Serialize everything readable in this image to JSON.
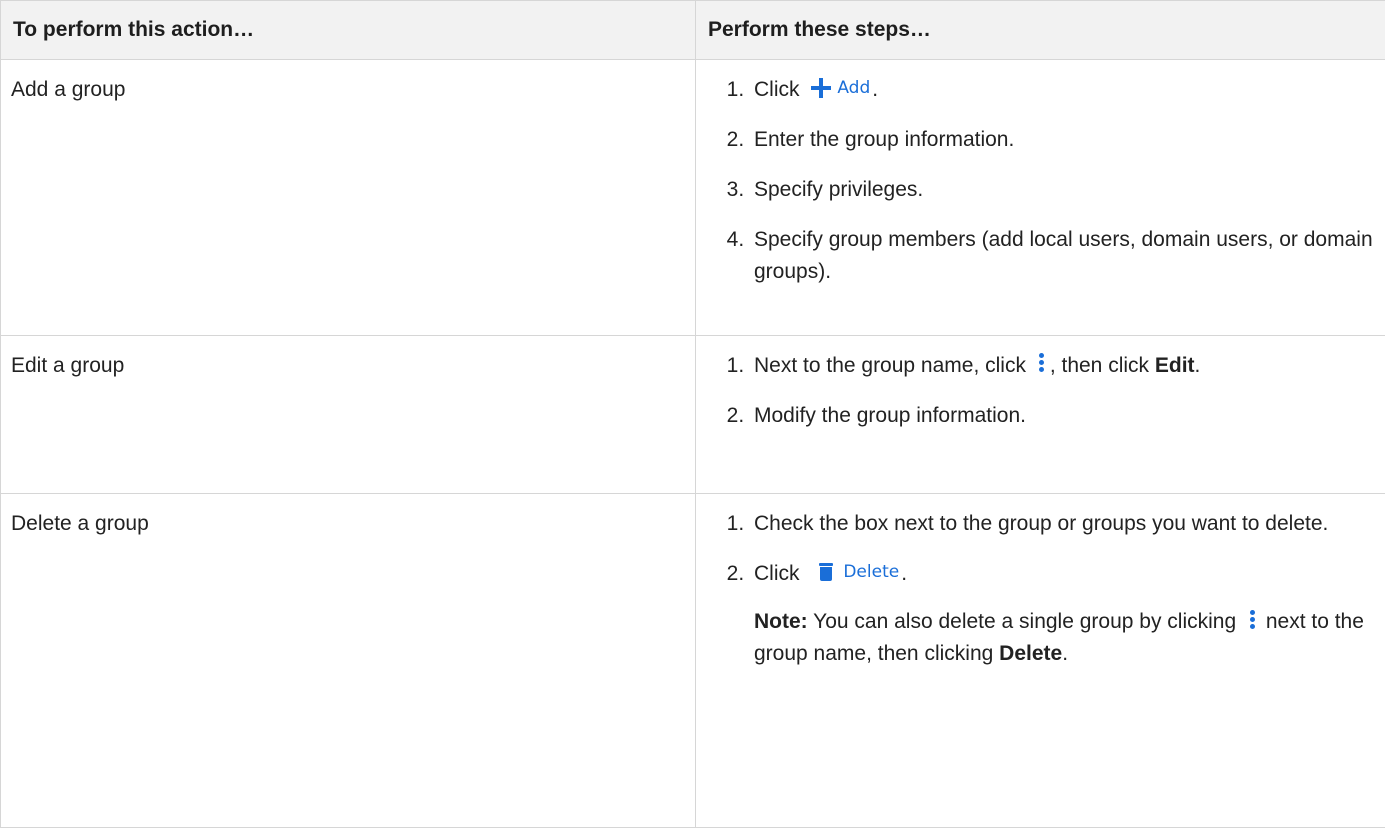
{
  "table": {
    "header": {
      "col1": "To perform this action…",
      "col2": "Perform these steps…"
    },
    "rows": [
      {
        "action": "Add a group",
        "steps": {
          "s1_prefix": "Click",
          "s1_button_label": "Add",
          "s1_button_icon": "plus-icon",
          "s1_suffix": ".",
          "s2": "Enter the group information.",
          "s3": "Specify privileges.",
          "s4": "Specify group members (add local users, domain users, or domain groups)."
        }
      },
      {
        "action": "Edit a group",
        "steps": {
          "s1_prefix": "Next to the group name, click",
          "s1_icon": "kebab-menu-icon",
          "s1_middle": ", then click",
          "s1_bold": "Edit",
          "s1_suffix": ".",
          "s2": "Modify the group information."
        }
      },
      {
        "action": "Delete a group",
        "steps": {
          "s1": "Check the box next to the group or groups you want to delete.",
          "s2_prefix": "Click",
          "s2_button_label": "Delete",
          "s2_button_icon": "trash-icon",
          "s2_suffix": ".",
          "note_label": "Note:",
          "note_text1": "You can also delete a single group by clicking",
          "note_icon": "kebab-menu-icon",
          "note_text2": "next to the group name, then clicking",
          "note_bold": "Delete",
          "note_end": "."
        }
      }
    ]
  },
  "colors": {
    "accent": "#1a6ed8",
    "header_bg": "#f2f2f2",
    "border": "#d6d6d6"
  }
}
